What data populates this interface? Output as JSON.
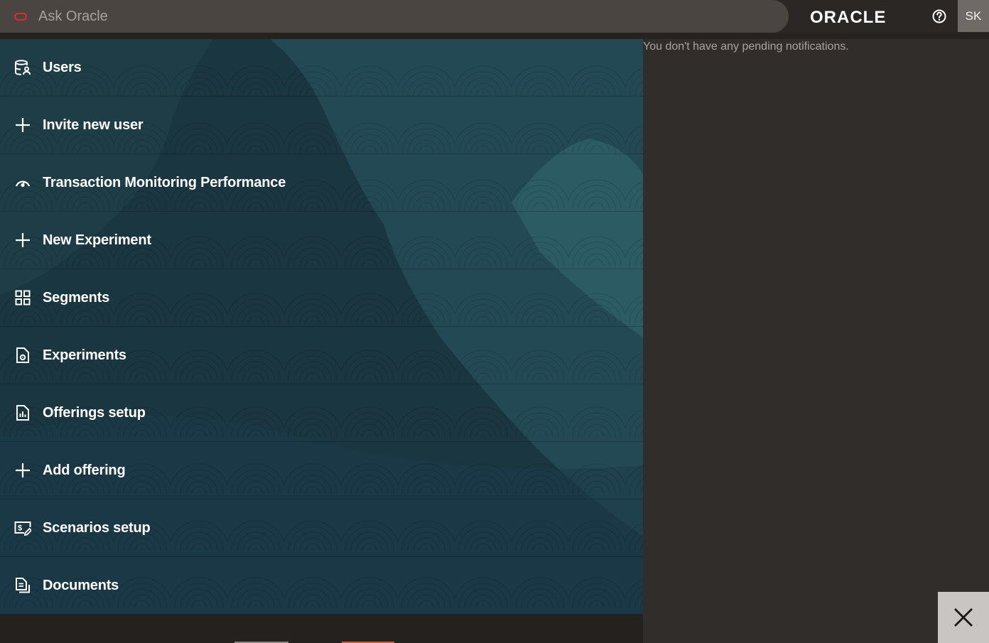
{
  "search": {
    "placeholder": "Ask Oracle"
  },
  "brand": {
    "logo_text": "ORACLE"
  },
  "user": {
    "initials": "SK"
  },
  "menu": {
    "items": [
      {
        "label": "Users",
        "icon": "user-database-icon"
      },
      {
        "label": "Invite new user",
        "icon": "plus-icon"
      },
      {
        "label": "Transaction Monitoring Performance",
        "icon": "gauge-icon"
      },
      {
        "label": "New Experiment",
        "icon": "plus-icon"
      },
      {
        "label": "Segments",
        "icon": "grid-icon"
      },
      {
        "label": "Experiments",
        "icon": "document-settings-icon"
      },
      {
        "label": "Offerings setup",
        "icon": "document-chart-icon"
      },
      {
        "label": "Add offering",
        "icon": "plus-icon"
      },
      {
        "label": "Scenarios setup",
        "icon": "scenario-edit-icon"
      },
      {
        "label": "Documents",
        "icon": "documents-icon"
      }
    ]
  },
  "notifications": {
    "empty_text": "You don't have any pending notifications."
  },
  "colors": {
    "accent_red": "#d9302c",
    "panel_bg": "#1f4049",
    "header_bg": "#2b2724",
    "notif_bg": "#312d2a"
  }
}
